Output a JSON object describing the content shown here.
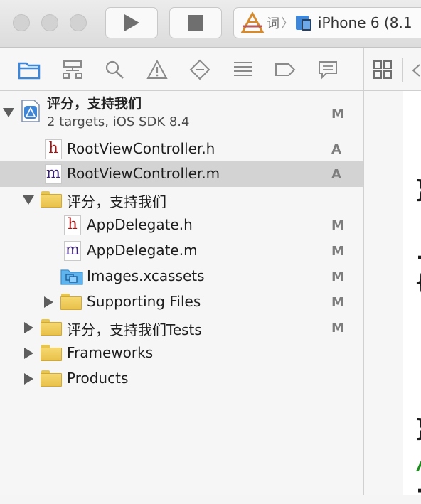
{
  "toolbar": {
    "run_icon": "play-icon",
    "stop_icon": "stop-icon",
    "scheme_app_label": "词",
    "scheme_separator": "〉",
    "scheme_device": "iPhone 6 (8.1"
  },
  "navigator_tabs": [
    {
      "icon": "folder-icon"
    },
    {
      "icon": "hierarchy-icon"
    },
    {
      "icon": "search-icon"
    },
    {
      "icon": "warning-icon"
    },
    {
      "icon": "diamond-icon"
    },
    {
      "icon": "list-icon"
    },
    {
      "icon": "tag-icon"
    },
    {
      "icon": "comment-icon"
    }
  ],
  "project": {
    "name": "评分，支持我们",
    "subtitle": "2 targets, iOS SDK 8.4",
    "status": "M"
  },
  "files": [
    {
      "name": "RootViewController.h",
      "status": "A",
      "type": "h"
    },
    {
      "name": "RootViewController.m",
      "status": "A",
      "type": "m"
    },
    {
      "name": "评分，支持我们",
      "status": "",
      "type": "folder"
    },
    {
      "name": "AppDelegate.h",
      "status": "M",
      "type": "h"
    },
    {
      "name": "AppDelegate.m",
      "status": "M",
      "type": "m"
    },
    {
      "name": "Images.xcassets",
      "status": "M",
      "type": "xcassets"
    },
    {
      "name": "Supporting Files",
      "status": "M",
      "type": "folder"
    },
    {
      "name": "评分，支持我们Tests",
      "status": "M",
      "type": "folder"
    },
    {
      "name": "Frameworks",
      "status": "",
      "type": "folder"
    },
    {
      "name": "Products",
      "status": "",
      "type": "folder"
    }
  ],
  "file_glyphs": {
    "h": "h",
    "m": "m"
  },
  "editor": {
    "code_fragments": [
      "}",
      "-",
      "{",
      "}",
      "/",
      "-"
    ]
  },
  "colors": {
    "selection": "#d3d3d3",
    "accent": "#3d86d8",
    "header_h": "#a31616",
    "header_m": "#3a2473",
    "comment_green": "#1f8c1f"
  }
}
